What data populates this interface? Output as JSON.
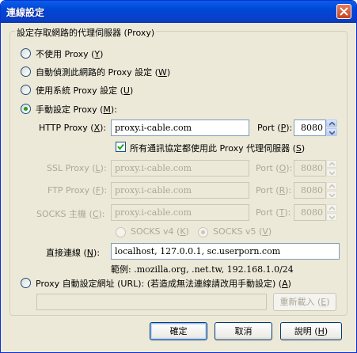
{
  "window": {
    "title": "連線設定"
  },
  "group": {
    "legend": "設定存取網路的代理伺服器 (Proxy)"
  },
  "modes": [
    {
      "label": "不使用 Proxy (",
      "key": "Y",
      "tail": ")",
      "selected": false
    },
    {
      "label": "自動偵測此網路的 Proxy 設定 (",
      "key": "W",
      "tail": ")",
      "selected": false
    },
    {
      "label": "使用系統 Proxy 設定 (",
      "key": "U",
      "tail": ")",
      "selected": false
    },
    {
      "label": "手動設定 Proxy (",
      "key": "M",
      "tail": "):",
      "selected": true
    }
  ],
  "manual": {
    "http": {
      "label": "HTTP Proxy (",
      "key": "X",
      "tail": "):",
      "value": "proxy.i-cable.com",
      "port_label": "Port (",
      "port_key": "P",
      "port_tail": "):",
      "port": "8080"
    },
    "share_all": {
      "label": "所有通訊協定都使用此 Proxy 代理伺服器 (",
      "key": "S",
      "tail": ")",
      "checked": true
    },
    "ssl": {
      "label": "SSL Proxy (",
      "key": "L",
      "tail": "):",
      "value": "proxy.i-cable.com",
      "port_label": "Port (",
      "port_key": "O",
      "port_tail": "):",
      "port": "8080"
    },
    "ftp": {
      "label": "FTP Proxy (",
      "key": "F",
      "tail": "):",
      "value": "proxy.i-cable.com",
      "port_label": "Port (",
      "port_key": "R",
      "port_tail": "):",
      "port": "8080"
    },
    "socks": {
      "label": "SOCKS 主機 (",
      "key": "C",
      "tail": "):",
      "value": "proxy.i-cable.com",
      "port_label": "Port (",
      "port_key": "T",
      "port_tail": "):",
      "port": "8080"
    },
    "socks_v4": {
      "label": "SOCKS v4 (",
      "key": "K",
      "tail": ")",
      "selected": false
    },
    "socks_v5": {
      "label": "SOCKS v5 (",
      "key": "V",
      "tail": ")",
      "selected": true
    },
    "no_proxy": {
      "label": "直接連線 (",
      "key": "N",
      "tail": "):",
      "value": "localhost, 127.0.0.1, sc.userporn.com"
    },
    "example": "範例: .mozilla.org, .net.tw, 192.168.1.0/24"
  },
  "auto_url": {
    "label": "Proxy 自動設定網址 (URL): (若造成無法連線請改用手動設定) (",
    "key": "A",
    "tail": ")",
    "selected": false,
    "value": "",
    "reload_label": "重新載入 (",
    "reload_key": "E",
    "reload_tail": ")"
  },
  "buttons": {
    "ok": "確定",
    "cancel": "取消",
    "help": "說明 (",
    "help_key": "H",
    "help_tail": ")"
  }
}
